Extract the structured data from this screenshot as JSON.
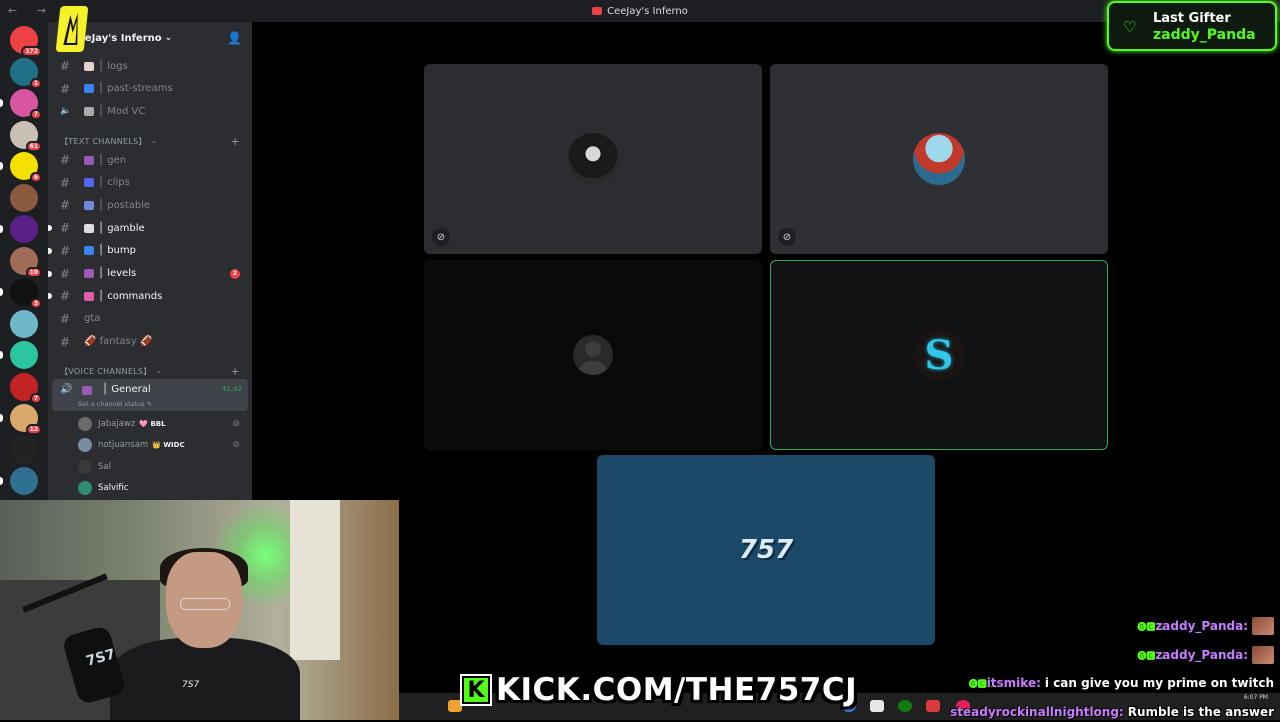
{
  "window": {
    "title": "CeeJay's Inferno",
    "nav": "← →",
    "controls": [
      "—",
      "□",
      "✕"
    ]
  },
  "colors": {
    "discord_bg": "#2b2d31",
    "rail_bg": "#1e1f22",
    "kick_green": "#53fc18",
    "speaking_green": "#3ba55c",
    "mention_red": "#f23f43"
  },
  "server_rail": [
    {
      "icon": "discord-home-icon",
      "badge": "172",
      "color": "#ed4245"
    },
    {
      "icon": "server-s-icon",
      "badge": "1",
      "color": "#1f6f86"
    },
    {
      "icon": "server-pink-icon",
      "badge": "7",
      "color": "#d855a0"
    },
    {
      "icon": "server-avatar-icon",
      "badge": "61",
      "color": "#c9c0b5"
    },
    {
      "icon": "server-w-icon",
      "badge": "6",
      "color": "#f5e100"
    },
    {
      "icon": "server-crowd-icon",
      "badge": "",
      "color": "#8a5a3c"
    },
    {
      "icon": "server-purple-icon",
      "badge": "",
      "color": "#5b1f8a"
    },
    {
      "icon": "server-face-icon",
      "badge": "10",
      "color": "#a06b57"
    },
    {
      "icon": "server-yt-icon",
      "badge": "3",
      "color": "#111111"
    },
    {
      "icon": "server-landscape-icon",
      "badge": "",
      "color": "#6fb7c9"
    },
    {
      "icon": "server-green-icon",
      "badge": "",
      "color": "#2cc5a0"
    },
    {
      "icon": "server-devil-icon",
      "badge": "7",
      "color": "#c22424"
    },
    {
      "icon": "server-anime-icon",
      "badge": "12",
      "color": "#d9a86c"
    },
    {
      "icon": "server-inferno-icon",
      "badge": "",
      "color": "#222222"
    },
    {
      "icon": "server-blue-icon",
      "badge": "",
      "color": "#2f6f90"
    }
  ],
  "server": {
    "name": "eeJay's Inferno",
    "logo_text": "❤️",
    "channels_top": [
      {
        "name": "│ logs",
        "icon_color": "#e8d0d0"
      },
      {
        "name": "│ past-streams",
        "icon_color": "#3b82f6"
      },
      {
        "name": "│ Mod VC",
        "icon_color": "#aaaaaa",
        "voice": true
      }
    ],
    "text_category": "【TEXT CHANNELS】",
    "text_channels": [
      {
        "name": "│ gen",
        "icon_color": "#9b59b6",
        "unread": false
      },
      {
        "name": "│ clips",
        "icon_color": "#5865f2",
        "unread": false
      },
      {
        "name": "│ postable",
        "icon_color": "#7289da",
        "unread": false
      },
      {
        "name": "│ gamble",
        "icon_color": "#dddddd",
        "unread": true
      },
      {
        "name": "│ bump",
        "icon_color": "#3b82f6",
        "unread": true
      },
      {
        "name": "│ levels",
        "icon_color": "#9b59b6",
        "unread": true,
        "mentions": "2"
      },
      {
        "name": "│ commands",
        "icon_color": "#e05daa",
        "unread": true
      },
      {
        "name": "gta",
        "icon_color": "",
        "unread": false,
        "no_hash": true
      },
      {
        "name": "🏈 fantasy 🏈",
        "icon_color": "",
        "unread": false
      }
    ],
    "voice_category": "【VOICE CHANNELS】",
    "voice_general": {
      "name": "│ General",
      "timer": "41:42",
      "status": "Set a channel status ✎"
    },
    "voice_users": [
      {
        "name": "Jabajawz",
        "tag": "🩷 BBL",
        "muted": true,
        "av": "#6a6a6a"
      },
      {
        "name": "notjuansam",
        "tag": "👑 WIDC",
        "muted": true,
        "av": "#7a8aa0"
      },
      {
        "name": "Sal",
        "tag": "",
        "muted": false,
        "av": "#3a3a3a"
      },
      {
        "name": "Salvific",
        "tag": "",
        "muted": false,
        "av": "#2e8b74",
        "bright": true
      }
    ]
  },
  "tiles": [
    {
      "id": "tile-1",
      "avatar_color": "#555555",
      "muted": true,
      "mic_icon": "⊘"
    },
    {
      "id": "tile-2",
      "avatar_color": "#3aa0c8",
      "muted": true,
      "mic_icon": "⊘"
    },
    {
      "id": "tile-3",
      "avatar_color": "",
      "muted": false
    },
    {
      "id": "tile-4",
      "avatar_text": "S",
      "avatar_color": "#2fc6e8",
      "speaking": true
    },
    {
      "id": "tile-5",
      "avatar_text": "757",
      "avatar_color": "#cfe4f0",
      "blue": true
    }
  ],
  "gifter": {
    "label": "Last Gifter",
    "user": "zaddy_Panda",
    "heart": "♡"
  },
  "kick_banner": {
    "k": "K",
    "text": "KICK.COM/THE757CJ"
  },
  "webcam": {
    "mic_logo": "7S7",
    "hoodie_logo": "7S7"
  },
  "chat": [
    {
      "badges": "🅖🅲 ≡",
      "user": "zaddy_Panda:",
      "msg": "",
      "face": true
    },
    {
      "badges": "🅖🅲 ≡",
      "user": "zaddy_Panda:",
      "msg": "",
      "face": true
    },
    {
      "badges": "🅖🅲 ⚔",
      "user": "itsmike:",
      "msg": "i can give you my prime on twitch",
      "face": false
    },
    {
      "badges": "",
      "user": "steadyrockinallnightlong:",
      "msg": "Rumble is the answer",
      "face": false
    }
  ],
  "taskbar": {
    "time": "6:07 PM",
    "date": ""
  }
}
